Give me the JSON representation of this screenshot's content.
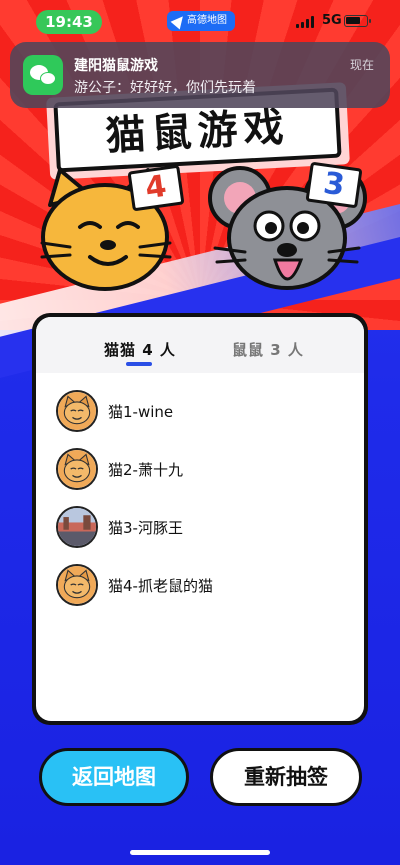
{
  "status_bar": {
    "time": "19:43",
    "map_app": "高德地图",
    "network": "5G"
  },
  "notification": {
    "app": "WeChat",
    "title": "建阳猫鼠游戏",
    "message": "游公子：好好好，你们先玩着",
    "time": "现在"
  },
  "game": {
    "title": "猫鼠游戏",
    "cat_count": "4",
    "mouse_count": "3"
  },
  "tabs": [
    {
      "label": "猫猫 4 人"
    },
    {
      "label": "鼠鼠 3 人"
    }
  ],
  "players": [
    {
      "name": "猫1-wine"
    },
    {
      "name": "猫2-萧十九"
    },
    {
      "name": "猫3-河豚王"
    },
    {
      "name": "猫4-抓老鼠的猫"
    }
  ],
  "buttons": {
    "back": "返回地图",
    "redraw": "重新抽签"
  }
}
